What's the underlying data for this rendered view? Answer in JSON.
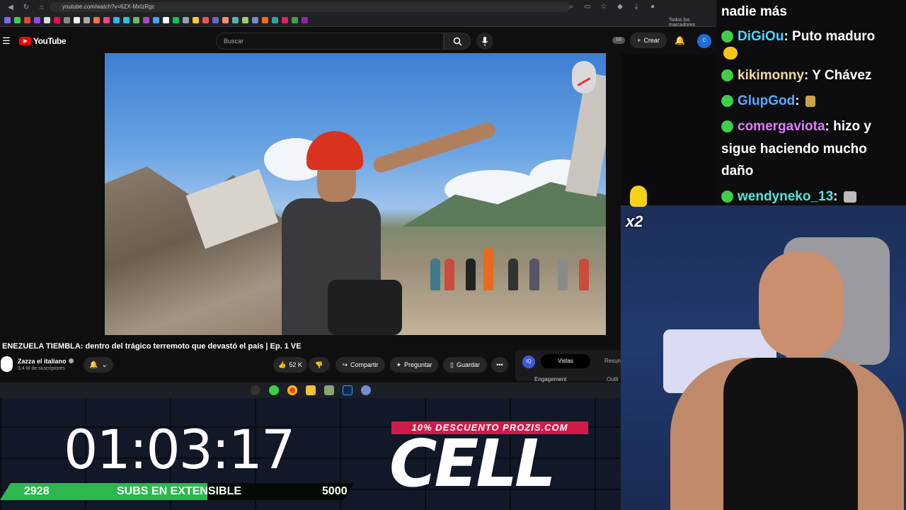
{
  "browser": {
    "url": "youtube.com/watch?v=6ZX-MxIzRgc",
    "bookmarks_all": "Todos los marcadores"
  },
  "youtube": {
    "logo_text": "YouTube",
    "search_placeholder": "Buscar",
    "ss_badge": "SS",
    "create_label": "Crear",
    "avatar_text": "C",
    "video_title": "ENEZUELA TIEMBLA: dentro del trágico terremoto que devastó el país | Ep. 1 VE",
    "channel_name": "Zazza el italiano",
    "subscribers": "3,4 M de suscriptores",
    "likes": "52 K",
    "share_label": "Compartir",
    "ask_label": "Preguntar",
    "save_label": "Guardar",
    "more_label": "•••"
  },
  "extension": {
    "logo": "IQ",
    "tab_active": "Vistas",
    "tab_other": "Resum",
    "label_left": "Engagement",
    "label_right": "Outli"
  },
  "overlay": {
    "timer": "01:03:17",
    "subs_current": "2928",
    "subs_label": "SUBS EN EXTENSIBLE",
    "subs_goal": "5000",
    "subs_progress": 0.5856,
    "promo": "10% DESCUENTO PROZIS.COM",
    "logo": "CELL",
    "emote_text": "x2"
  },
  "chat": [
    {
      "user": "",
      "text": "nadie más",
      "color": "#ffffff"
    },
    {
      "user": "DiGiOu",
      "text": ": Puto maduro",
      "color": "#4fd4ff"
    },
    {
      "user": "kikimonny",
      "text": ": Y Chávez",
      "color": "#f0d9a0"
    },
    {
      "user": "GlupGod",
      "text": ":",
      "color": "#5aa9ff"
    },
    {
      "user": "comergaviota",
      "text": ": hizo y",
      "color": "#e07cff"
    },
    {
      "user": "",
      "text": "sigue haciendo mucho",
      "color": "#ffffff"
    },
    {
      "user": "",
      "text": "daño",
      "color": "#ffffff"
    },
    {
      "user": "wendyneko_13",
      "text": ":",
      "color": "#4fe8d8"
    }
  ]
}
